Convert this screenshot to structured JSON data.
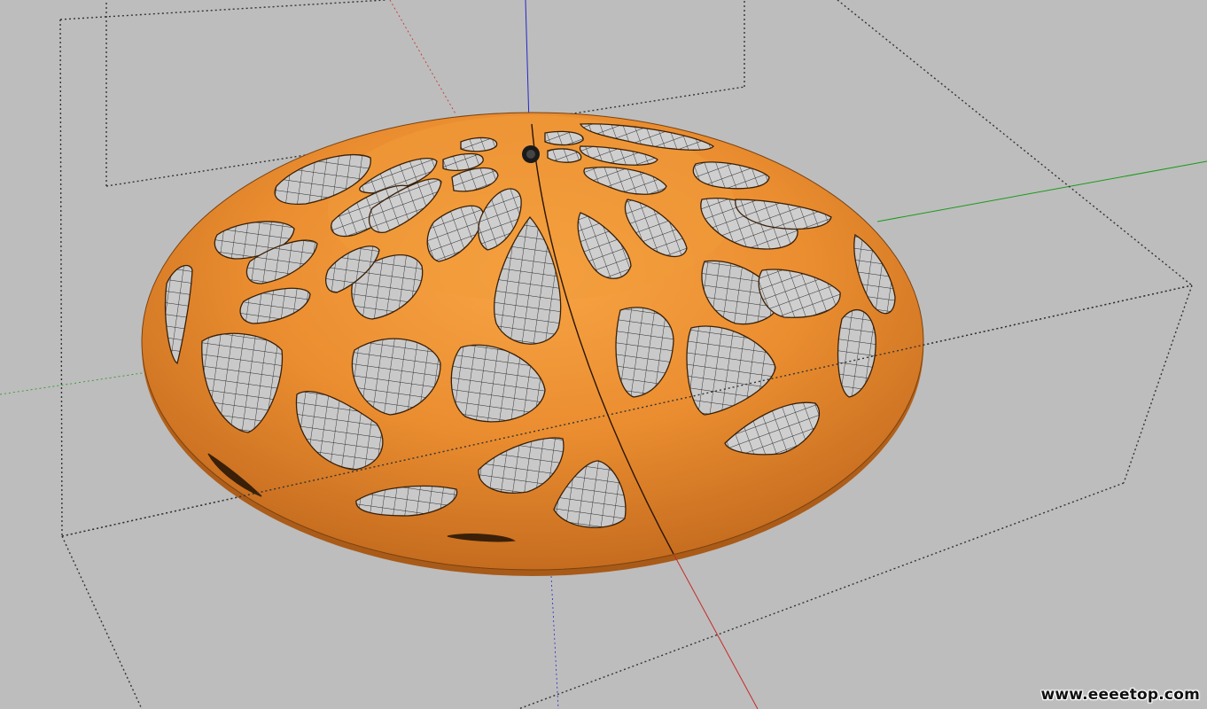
{
  "viewport": {
    "background": "#bdbdbd",
    "axis_colors": {
      "red": "#c82828",
      "green": "#1a9a1a",
      "blue": "#2727c8"
    },
    "model_color": "#e8892c",
    "bounding_box_style": "dotted"
  },
  "watermark": {
    "text": "www.eeeetop.com"
  }
}
